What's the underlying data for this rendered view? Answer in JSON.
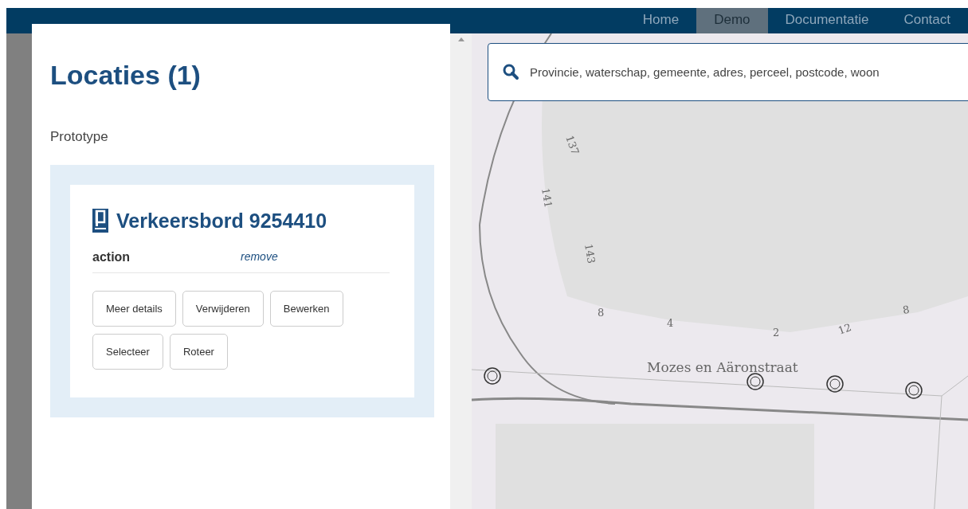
{
  "nav": [
    {
      "label": "Home",
      "selected": false
    },
    {
      "label": "Demo",
      "selected": true
    },
    {
      "label": "Documentatie",
      "selected": false
    },
    {
      "label": "Contact",
      "selected": false
    }
  ],
  "panel": {
    "title": "Locaties",
    "count": "(1)",
    "subtitle": "Prototype",
    "card": {
      "title": "Verkeersbord 9254410",
      "field_label": "action",
      "field_value": "remove",
      "buttons": [
        "Meer details",
        "Verwijderen",
        "Bewerken",
        "Selecteer",
        "Roteer"
      ]
    }
  },
  "map": {
    "search": {
      "placeholder": "Provincie, waterschap, gemeente, adres, perceel, postcode, woon"
    },
    "street_label": "Mozes en Aäronstraat",
    "house_numbers": [
      "137",
      "141",
      "143",
      "8",
      "4",
      "2",
      "12",
      "8"
    ]
  }
}
